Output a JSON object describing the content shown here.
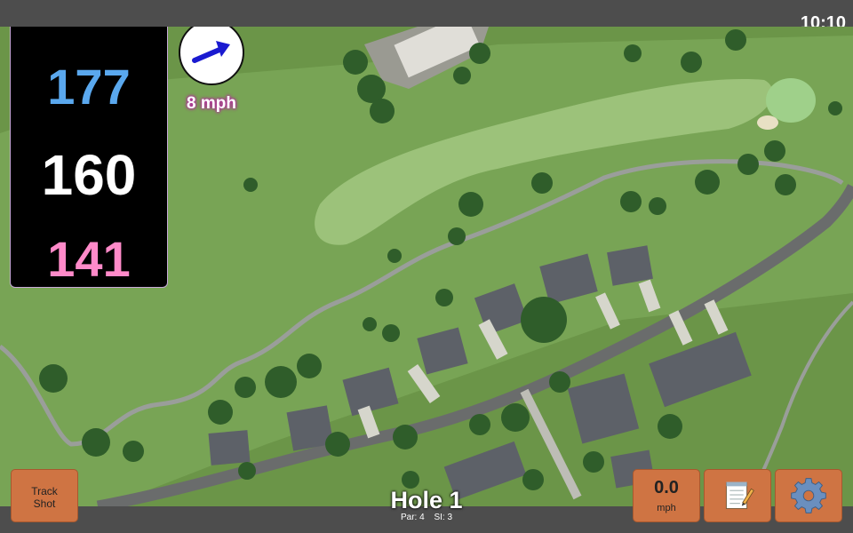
{
  "status": {
    "time": "10:10"
  },
  "distances": {
    "back": "177",
    "middle": "160",
    "front": "141"
  },
  "wind": {
    "speed": "8 mph",
    "arrow_icon": "wind-arrow-icon"
  },
  "hole": {
    "title": "Hole 1",
    "par": "Par: 4",
    "si": "SI: 3"
  },
  "buttons": {
    "track_shot_line1": "Track",
    "track_shot_line2": "Shot",
    "speed_value": "0.0",
    "speed_unit": "mph",
    "notes_icon": "notepad-icon",
    "settings_icon": "gear-icon"
  },
  "colors": {
    "back": "#5aa8ee",
    "middle": "#ffffff",
    "front": "#ff8ac9",
    "button": "#cf7443",
    "wind_arrow": "#1a1ad0"
  }
}
